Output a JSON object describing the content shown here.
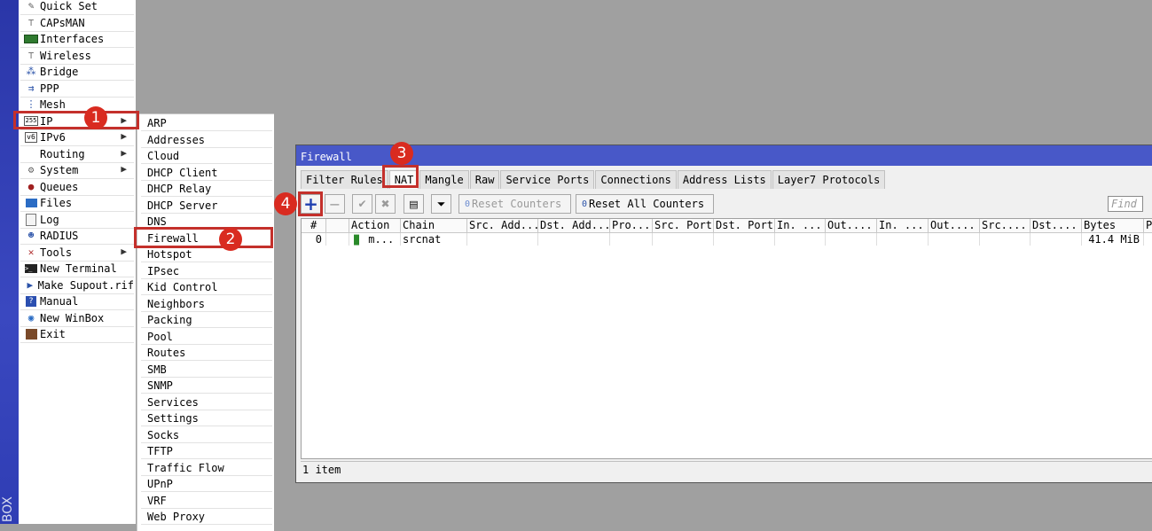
{
  "sidebar": {
    "vertical_text": "BOX"
  },
  "menu": {
    "items": [
      {
        "label": "Quick Set",
        "icon": "quick-set-icon",
        "arrow": ""
      },
      {
        "label": "CAPsMAN",
        "icon": "capsman-icon",
        "arrow": ""
      },
      {
        "label": "Interfaces",
        "icon": "interfaces-icon",
        "arrow": ""
      },
      {
        "label": "Wireless",
        "icon": "wireless-icon",
        "arrow": ""
      },
      {
        "label": "Bridge",
        "icon": "bridge-icon",
        "arrow": ""
      },
      {
        "label": "PPP",
        "icon": "ppp-icon",
        "arrow": ""
      },
      {
        "label": "Mesh",
        "icon": "mesh-icon",
        "arrow": ""
      },
      {
        "label": "IP",
        "icon": "ip-icon",
        "arrow": "▶"
      },
      {
        "label": "IPv6",
        "icon": "ipv6-icon",
        "arrow": "▶"
      },
      {
        "label": "Routing",
        "icon": "",
        "arrow": "▶"
      },
      {
        "label": "System",
        "icon": "system-gear-icon",
        "arrow": "▶"
      },
      {
        "label": "Queues",
        "icon": "queues-icon",
        "arrow": ""
      },
      {
        "label": "Files",
        "icon": "files-folder-icon",
        "arrow": ""
      },
      {
        "label": "Log",
        "icon": "log-icon",
        "arrow": ""
      },
      {
        "label": "RADIUS",
        "icon": "radius-icon",
        "arrow": ""
      },
      {
        "label": "Tools",
        "icon": "tools-icon",
        "arrow": "▶"
      },
      {
        "label": "New Terminal",
        "icon": "terminal-icon",
        "arrow": ""
      },
      {
        "label": "Make Supout.rif",
        "icon": "supout-icon",
        "arrow": ""
      },
      {
        "label": "Manual",
        "icon": "manual-icon",
        "arrow": ""
      },
      {
        "label": "New WinBox",
        "icon": "winbox-icon",
        "arrow": ""
      },
      {
        "label": "Exit",
        "icon": "exit-icon",
        "arrow": ""
      }
    ]
  },
  "submenu": {
    "items": [
      "ARP",
      "Addresses",
      "Cloud",
      "DHCP Client",
      "DHCP Relay",
      "DHCP Server",
      "DNS",
      "Firewall",
      "Hotspot",
      "IPsec",
      "Kid Control",
      "Neighbors",
      "Packing",
      "Pool",
      "Routes",
      "SMB",
      "SNMP",
      "Services",
      "Settings",
      "Socks",
      "TFTP",
      "Traffic Flow",
      "UPnP",
      "VRF",
      "Web Proxy"
    ]
  },
  "annotations": [
    "1",
    "2",
    "3",
    "4"
  ],
  "firewall": {
    "title": "Firewall",
    "tabs": [
      "Filter Rules",
      "NAT",
      "Mangle",
      "Raw",
      "Service Ports",
      "Connections",
      "Address Lists",
      "Layer7 Protocols"
    ],
    "active_tab": "NAT",
    "toolbar": {
      "reset_counters": "Reset Counters",
      "reset_all_counters": "Reset All Counters",
      "find_placeholder": "Find"
    },
    "columns": [
      "#",
      "",
      "Action",
      "Chain",
      "Src. Add...",
      "Dst. Add...",
      "Pro...",
      "Src. Port",
      "Dst. Port",
      "In. ...",
      "Out....",
      "In. ...",
      "Out....",
      "Src....",
      "Dst....",
      "Bytes",
      "P"
    ],
    "rows": [
      {
        "num": "0",
        "action": "m...",
        "chain": "srcnat",
        "bytes": "41.4 MiB"
      }
    ],
    "status": "1 item"
  },
  "colors": {
    "titlebar": "#4858c8",
    "highlight": "#c4302b",
    "badge": "#d92b20",
    "add": "#1f3fb0"
  }
}
